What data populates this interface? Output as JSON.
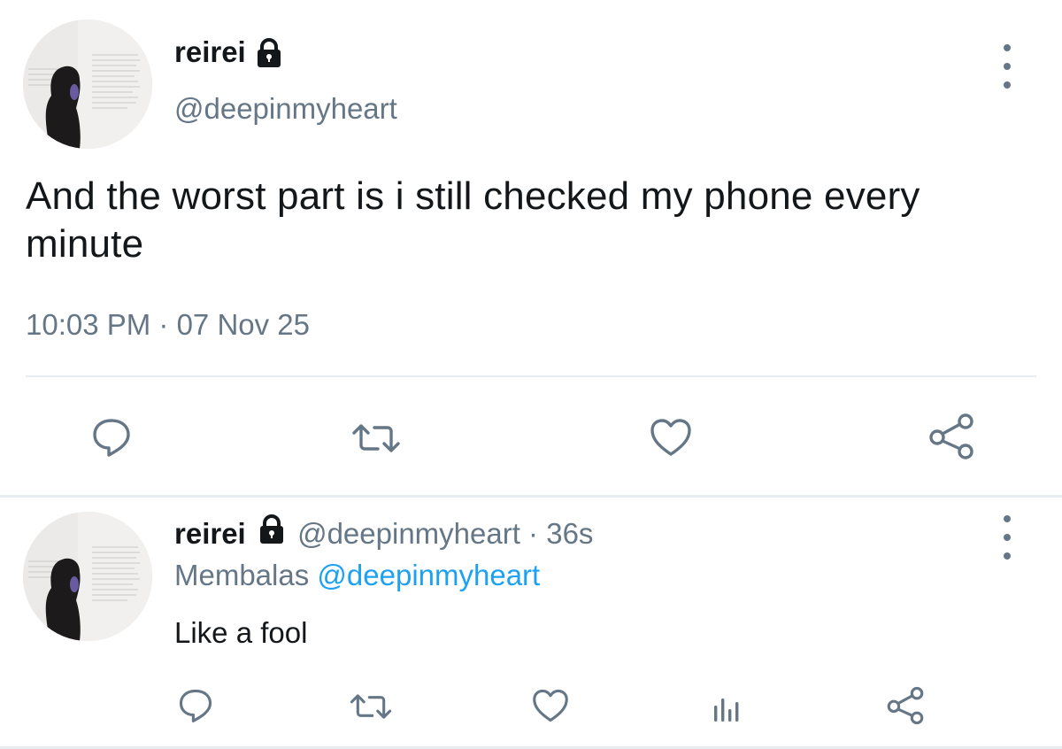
{
  "main_tweet": {
    "display_name": "reirei",
    "handle": "@deepinmyheart",
    "text": "And the worst part is i still checked my phone every minute",
    "timestamp": "10:03 PM · 07 Nov 25"
  },
  "reply_tweet": {
    "display_name": "reirei",
    "handle": "@deepinmyheart",
    "separator": " · ",
    "time_ago": "36s",
    "reply_to_label": "Membalas",
    "reply_to_handle": "@deepinmyheart",
    "text": "Like a fool"
  },
  "icons": {
    "lock": "lock-icon",
    "more": "more-vertical-icon",
    "reply": "reply-icon",
    "retweet": "retweet-icon",
    "like": "heart-icon",
    "analytics": "analytics-icon",
    "share": "share-icon"
  },
  "colors": {
    "text": "#14171a",
    "secondary": "#657786",
    "mention": "#1da1f2",
    "divider": "#e6ecf0"
  }
}
